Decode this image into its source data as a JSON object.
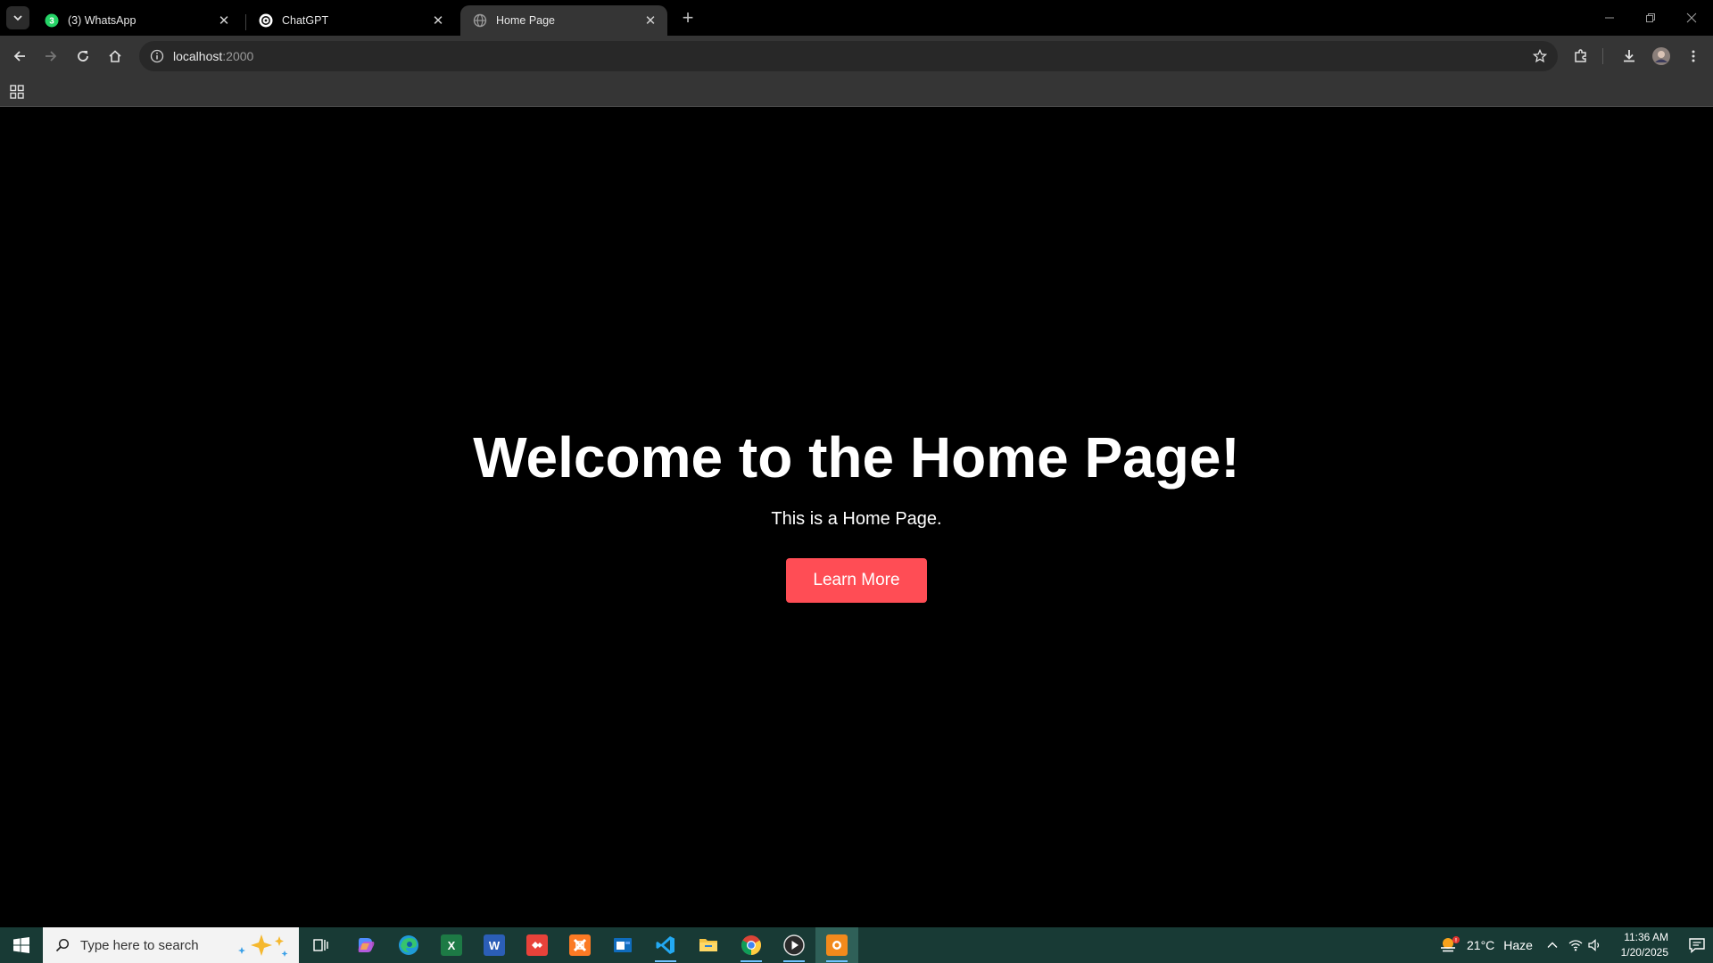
{
  "browser": {
    "tabs": [
      {
        "title": "(3) WhatsApp",
        "favicon": "whatsapp-icon",
        "badge": "3"
      },
      {
        "title": "ChatGPT",
        "favicon": "chatgpt-icon"
      },
      {
        "title": "Home Page",
        "favicon": "globe-icon",
        "active": true
      }
    ],
    "address": {
      "host": "localhost",
      "port": ":2000"
    }
  },
  "page": {
    "heading": "Welcome to the Home Page!",
    "subtitle": "This is a Home Page.",
    "button_label": "Learn More",
    "button_color": "#ff4d55",
    "background": "#000000"
  },
  "taskbar": {
    "search_placeholder": "Type here to search",
    "apps": [
      "task-view-icon",
      "copilot-icon",
      "edge-icon",
      "excel-icon",
      "word-icon",
      "anydesk-icon",
      "xampp-icon",
      "outlook-icon",
      "vscode-icon",
      "file-explorer-icon",
      "chrome-icon",
      "media-player-icon",
      "app-icon"
    ],
    "weather": {
      "temp": "21°C",
      "condition": "Haze"
    },
    "clock": {
      "time": "11:36 AM",
      "date": "1/20/2025"
    }
  }
}
